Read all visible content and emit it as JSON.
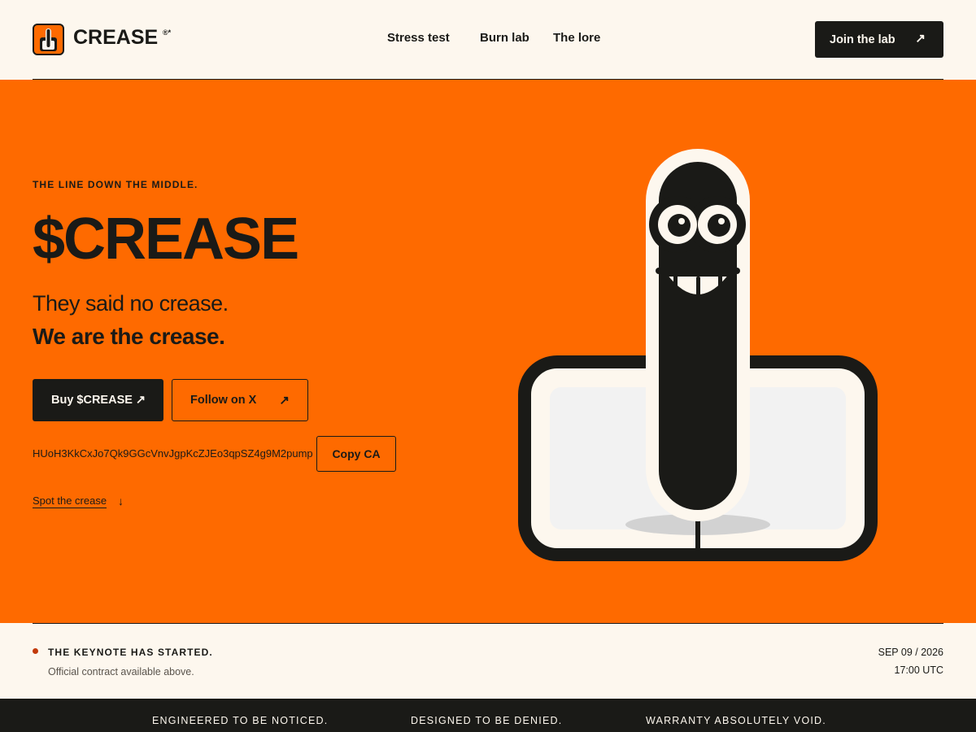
{
  "header": {
    "brand": "CREASE",
    "brand_mark": "®*",
    "nav": [
      "Stress test",
      "Burn lab",
      "The lore"
    ],
    "join_label": "Join the lab",
    "join_icon": "arrow-up-right-icon"
  },
  "hero": {
    "eyebrow": "THE LINE DOWN THE MIDDLE.",
    "title": "$CREASE",
    "tagline_1": "They said no crease.",
    "tagline_2": "We are the crease.",
    "buy_label": "Buy $CREASE",
    "follow_label": "Follow on X",
    "contract_address": "HUoH3KkCxJo7Qk9GGcVnvJgpKcZJEo3qpSZ4g9M2pump",
    "copy_label": "Copy CA",
    "spot_label": "Spot the crease"
  },
  "status": {
    "title": "THE KEYNOTE HAS STARTED.",
    "subtitle": "Official contract available above.",
    "date": "SEP 09 / 2026",
    "time": "17:00 UTC"
  },
  "band": [
    "ENGINEERED TO BE NOTICED.",
    "DESIGNED TO BE DENIED.",
    "WARRANTY ABSOLUTELY VOID."
  ],
  "colors": {
    "accent": "#fe6a00",
    "ink": "#1a1a17",
    "paper": "#fdf7ee",
    "status_dot": "#c23a0a"
  }
}
